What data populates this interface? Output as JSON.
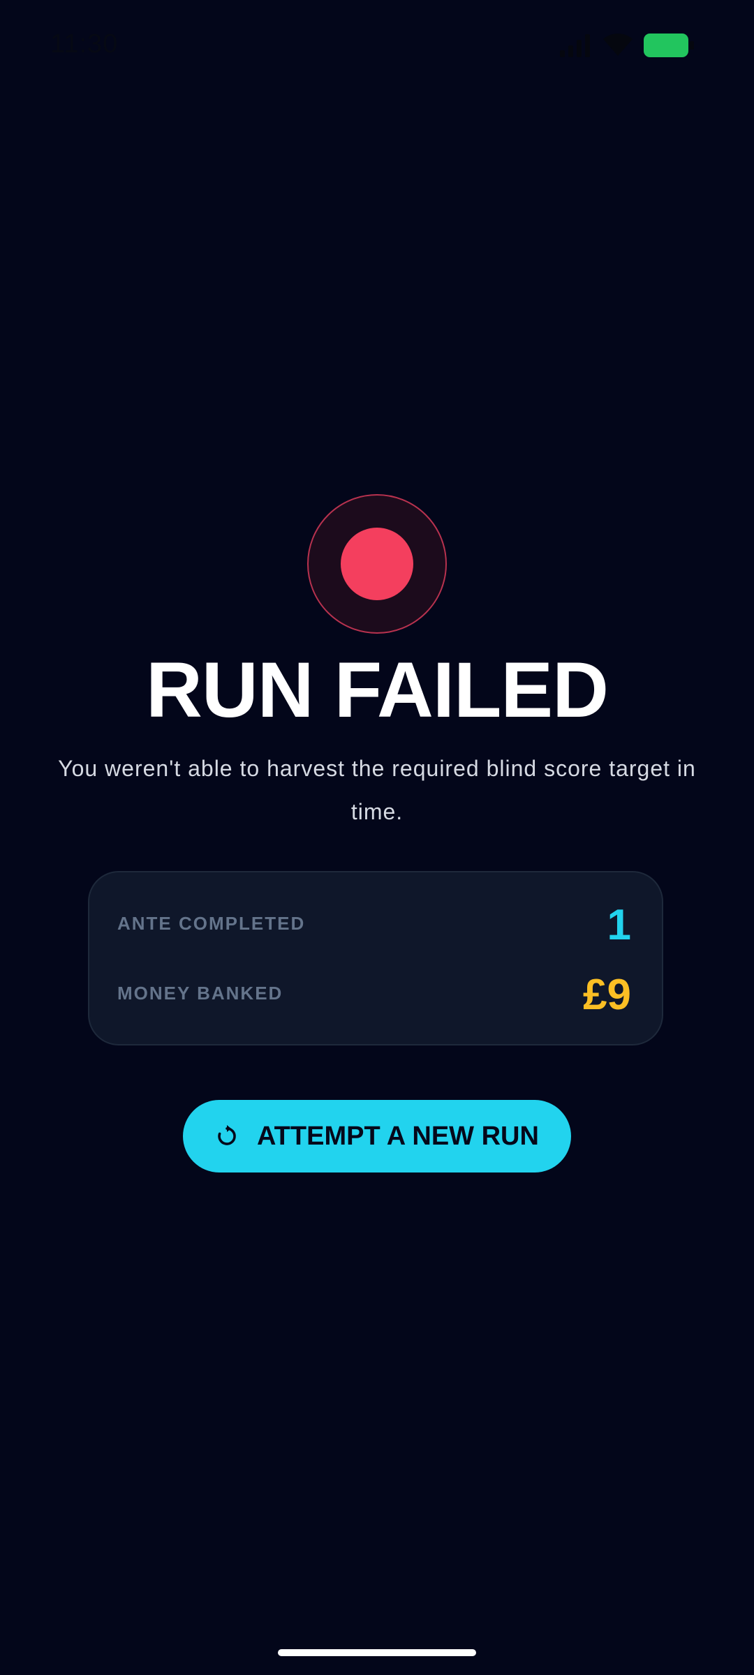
{
  "status_bar": {
    "time": "11:30",
    "icons": [
      "signal-icon",
      "wifi-icon",
      "battery-icon"
    ],
    "battery_color": "#22c55e"
  },
  "result": {
    "icon": "fail-dot-icon",
    "title": "RUN FAILED",
    "message": "You weren't able to harvest the required blind score target in time."
  },
  "stats": {
    "ante_label": "ANTE COMPLETED",
    "ante_value": "1",
    "money_label": "MONEY BANKED",
    "money_value": "£9"
  },
  "actions": {
    "retry_icon": "restart-icon",
    "retry_label": "ATTEMPT A NEW RUN"
  },
  "colors": {
    "background": "#03061a",
    "accent": "#22d3ee",
    "danger": "#f43f5e",
    "money": "#fbbf24",
    "card": "#0f172a"
  }
}
